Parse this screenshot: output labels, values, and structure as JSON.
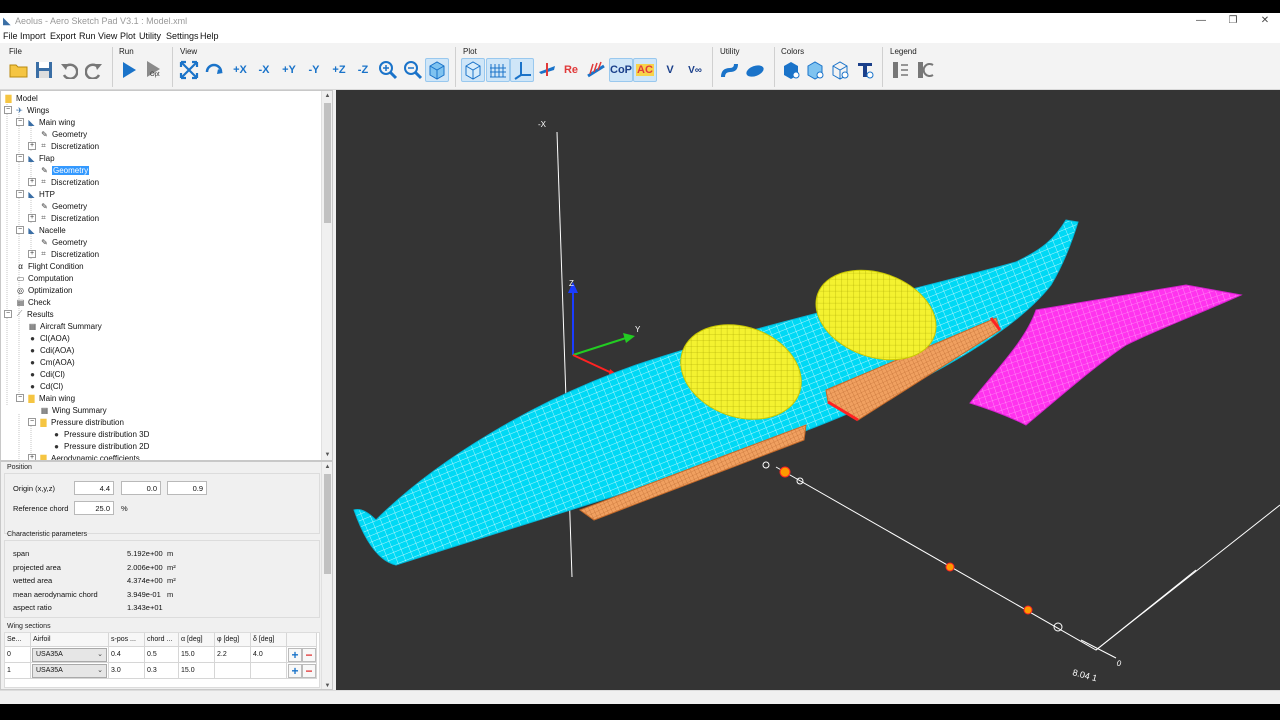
{
  "window": {
    "title": "Aeolus - Aero Sketch Pad V3.1 : Model.xml",
    "minimize": "—",
    "maximize": "❐",
    "close": "✕"
  },
  "menu": [
    "File",
    "Import",
    "Export",
    "Run",
    "View",
    "Plot",
    "Utility",
    "Settings",
    "Help"
  ],
  "toolbar": {
    "groups": [
      "File",
      "Run",
      "View",
      "Plot",
      "Utility",
      "Colors",
      "Legend"
    ],
    "run_opt_label": "Opt",
    "view_buttons": [
      "+X",
      "-X",
      "+Y",
      "-Y",
      "+Z",
      "-Z"
    ],
    "plot_text_buttons": [
      "Re",
      "C",
      "CoP",
      "AC",
      "V",
      "V∞"
    ]
  },
  "tree": [
    {
      "label": "Model",
      "icon": "folder-icon",
      "level": 0
    },
    {
      "label": "Wings",
      "icon": "plane-icon",
      "level": 1,
      "expander": "−"
    },
    {
      "label": "Main wing",
      "icon": "wing-icon",
      "level": 2,
      "expander": "−"
    },
    {
      "label": "Geometry",
      "icon": "pencil-icon",
      "level": 3
    },
    {
      "label": "Discretization",
      "icon": "mesh-icon",
      "level": 3,
      "expander": "+"
    },
    {
      "label": "Flap",
      "icon": "wing-icon",
      "level": 2,
      "expander": "−"
    },
    {
      "label": "Geometry",
      "icon": "pencil-icon",
      "level": 3,
      "selected": true
    },
    {
      "label": "Discretization",
      "icon": "mesh-icon",
      "level": 3,
      "expander": "+"
    },
    {
      "label": "HTP",
      "icon": "wing-icon",
      "level": 2,
      "expander": "−"
    },
    {
      "label": "Geometry",
      "icon": "pencil-icon",
      "level": 3
    },
    {
      "label": "Discretization",
      "icon": "mesh-icon",
      "level": 3,
      "expander": "+"
    },
    {
      "label": "Nacelle",
      "icon": "wing-icon",
      "level": 2,
      "expander": "−"
    },
    {
      "label": "Geometry",
      "icon": "pencil-icon",
      "level": 3
    },
    {
      "label": "Discretization",
      "icon": "mesh-icon",
      "level": 3,
      "expander": "+"
    },
    {
      "label": "Flight Condition",
      "icon": "alpha-icon",
      "level": 1
    },
    {
      "label": "Computation",
      "icon": "monitor-icon",
      "level": 1
    },
    {
      "label": "Optimization",
      "icon": "target-icon",
      "level": 1
    },
    {
      "label": "Check",
      "icon": "checklist-icon",
      "level": 1
    },
    {
      "label": "Results",
      "icon": "chart-icon",
      "level": 1,
      "expander": "−"
    },
    {
      "label": "Aircraft Summary",
      "icon": "table-icon",
      "level": 2
    },
    {
      "label": "Cl(AOA)",
      "icon": "dot-icon",
      "level": 2
    },
    {
      "label": "Cdi(AOA)",
      "icon": "dot-icon",
      "level": 2
    },
    {
      "label": "Cm(AOA)",
      "icon": "dot-icon",
      "level": 2
    },
    {
      "label": "Cdi(Cl)",
      "icon": "dot-icon",
      "level": 2
    },
    {
      "label": "Cd(Cl)",
      "icon": "dot-icon",
      "level": 2
    },
    {
      "label": "Main wing",
      "icon": "folder-icon",
      "level": 2,
      "expander": "−"
    },
    {
      "label": "Wing Summary",
      "icon": "table-icon",
      "level": 3
    },
    {
      "label": "Pressure distribution",
      "icon": "folder-icon",
      "level": 3,
      "expander": "−"
    },
    {
      "label": "Pressure distribution 3D",
      "icon": "dot-icon",
      "level": 4
    },
    {
      "label": "Pressure distribution 2D",
      "icon": "dot-icon",
      "level": 4
    },
    {
      "label": "Aerodynamic coefficients",
      "icon": "folder-icon",
      "level": 3,
      "expander": "+"
    }
  ],
  "position": {
    "section": "Position",
    "origin_label": "Origin (x,y,z)",
    "origin": [
      "4.4",
      "0.0",
      "0.9"
    ],
    "refchord_label": "Reference chord",
    "refchord": "25.0",
    "refchord_unit": "%"
  },
  "characteristics": {
    "section": "Characteristic parameters",
    "rows": [
      {
        "label": "span",
        "value": "5.192e+00",
        "unit": "m"
      },
      {
        "label": "projected area",
        "value": "2.006e+00",
        "unit": "m²"
      },
      {
        "label": "wetted area",
        "value": "4.374e+00",
        "unit": "m²"
      },
      {
        "label": "mean aerodynamic chord",
        "value": "3.949e-01",
        "unit": "m"
      },
      {
        "label": "aspect ratio",
        "value": "1.343e+01",
        "unit": ""
      }
    ]
  },
  "sections": {
    "title": "Wing sections",
    "headers": [
      "Se...",
      "Airfoil",
      "s-pos ...",
      "chord ...",
      "α [deg]",
      "φ [deg]",
      "δ [deg]"
    ],
    "rows": [
      {
        "sec": "0",
        "airfoil": "USA35A",
        "spos": "0.4",
        "chord": "0.5",
        "alpha": "15.0",
        "phi": "2.2",
        "delta": "4.0"
      },
      {
        "sec": "1",
        "airfoil": "USA35A",
        "spos": "3.0",
        "chord": "0.3",
        "alpha": "15.0",
        "phi": "",
        "delta": ""
      }
    ],
    "add": "+",
    "remove": "−"
  },
  "viewport": {
    "axis_labels": [
      "-X",
      "Z",
      "Y",
      "X"
    ],
    "probe_label": "8.04 1",
    "colors": {
      "wing": "#00e5ff",
      "flap": "#ff9a3c",
      "nacelle": "#ffff33",
      "htp": "#ff33ff",
      "background": "#343434"
    }
  }
}
